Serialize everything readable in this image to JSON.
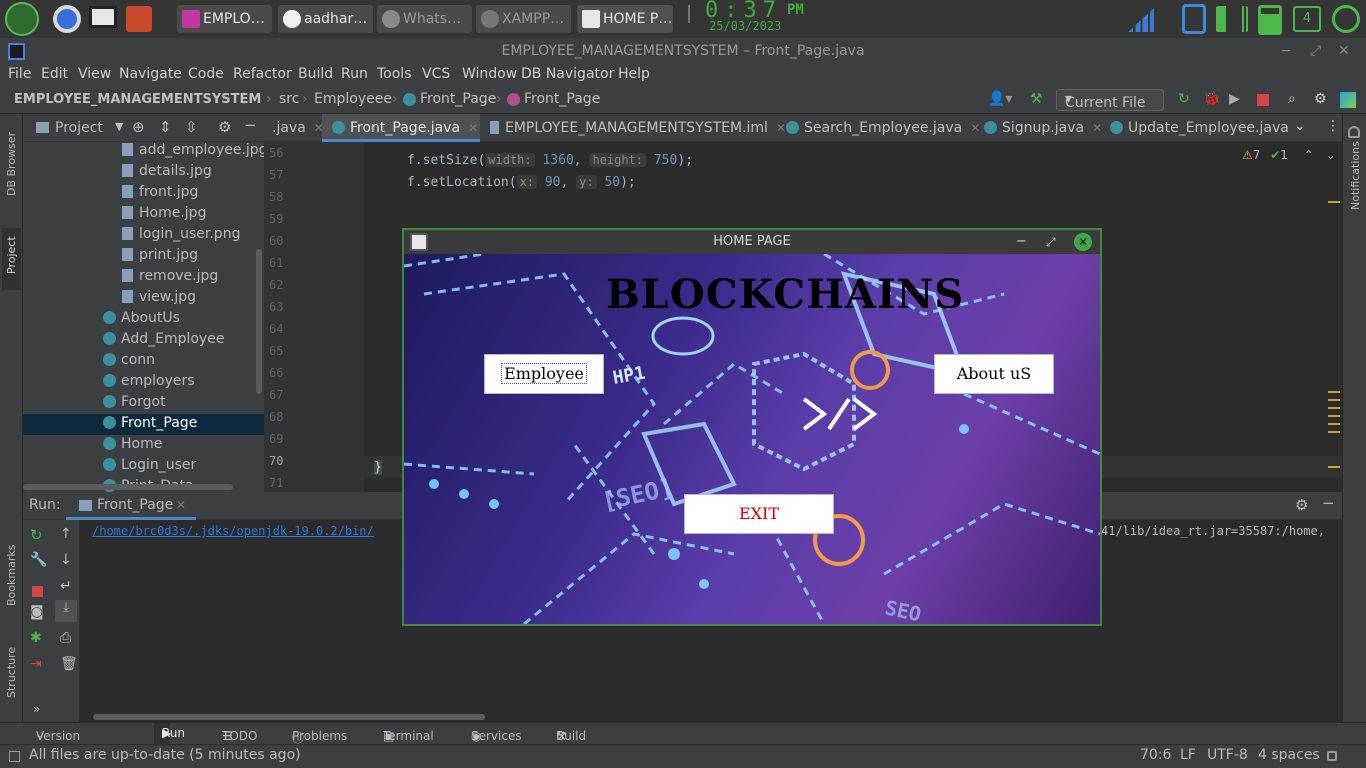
{
  "taskbar": {
    "items": [
      {
        "label": "EMPLO…"
      },
      {
        "label": "aadhar…"
      },
      {
        "label": "Whats…"
      },
      {
        "label": "XAMPP…"
      },
      {
        "label": "HOME P…"
      }
    ],
    "time": "0:37",
    "ampm": "PM",
    "date": "25/03/2023",
    "notif_count": "4"
  },
  "window": {
    "title": "EMPLOYEE_MANAGEMENTSYSTEM – Front_Page.java"
  },
  "menu": [
    "File",
    "Edit",
    "View",
    "Navigate",
    "Code",
    "Refactor",
    "Build",
    "Run",
    "Tools",
    "VCS",
    "Window",
    "DB Navigator",
    "Help"
  ],
  "breadcrumb": {
    "project": "EMPLOYEE_MANAGEMENTSYSTEM",
    "src": "src",
    "package": "Employeee",
    "file": "Front_Page",
    "method": "Front_Page"
  },
  "run_config": "Current File",
  "left_strip": {
    "db": "DB Browser",
    "project": "Project",
    "bookmarks": "Bookmarks",
    "structure": "Structure"
  },
  "right_strip": {
    "notifications": "Notifications"
  },
  "project_panel": {
    "title": "Project",
    "files": [
      "add_employee.jpg",
      "details.jpg",
      "front.jpg",
      "Home.jpg",
      "login_user.png",
      "print.jpg",
      "remove.jpg",
      "view.jpg"
    ],
    "classes": [
      "AboutUs",
      "Add_Employee",
      "conn",
      "employers",
      "Forgot",
      "Front_Page",
      "Home",
      "Login_user",
      "Print_Data"
    ]
  },
  "editor": {
    "tabs": [
      ".java",
      "Front_Page.java",
      "EMPLOYEE_MANAGEMENTSYSTEM.iml",
      "Search_Employee.java",
      "Signup.java",
      "Update_Employee.java"
    ],
    "warnings": "7",
    "oks": "1",
    "line_numbers": [
      "56",
      "57",
      "58",
      "59",
      "60",
      "61",
      "62",
      "63",
      "64",
      "65",
      "66",
      "67",
      "68",
      "69",
      "70",
      "71"
    ],
    "code": {
      "l56_pre": "f.setSize(",
      "l56_h1": "width:",
      "l56_v1": "1360",
      "l56_h2": "height:",
      "l56_v2": "750",
      "l56_post": ");",
      "l57_pre": "f.setLocation(",
      "l57_h1": "x:",
      "l57_v1": "90",
      "l57_h2": "y:",
      "l57_v2": "50",
      "l57_post": ");",
      "l70": "}"
    }
  },
  "run_panel": {
    "label": "Run:",
    "tab": "Front_Page",
    "output_left": "/home/brc0d3s/.jdks/openjdk-19.0.2/bin/",
    "output_right": "41/lib/idea_rt.jar=35587:/home,"
  },
  "bottom_tabs": [
    "Version Control",
    "Run",
    "TODO",
    "Problems",
    "Terminal",
    "Services",
    "Build"
  ],
  "status": {
    "message": "All files are up-to-date (5 minutes ago)",
    "position": "70:6",
    "line_sep": "LF",
    "encoding": "UTF-8",
    "indent": "4 spaces"
  },
  "swing_window": {
    "title": "HOME PAGE",
    "heading": "BLOCKCHAINS",
    "employee_button": "Employee",
    "about_button": "About uS",
    "exit_button": "EXIT",
    "image_text": {
      "hp": "HP1",
      "seo": "[SEO]",
      "seo2": "SEO"
    }
  },
  "colors": {
    "accent_green": "#3fae3f",
    "exit_red": "#cc0000"
  }
}
